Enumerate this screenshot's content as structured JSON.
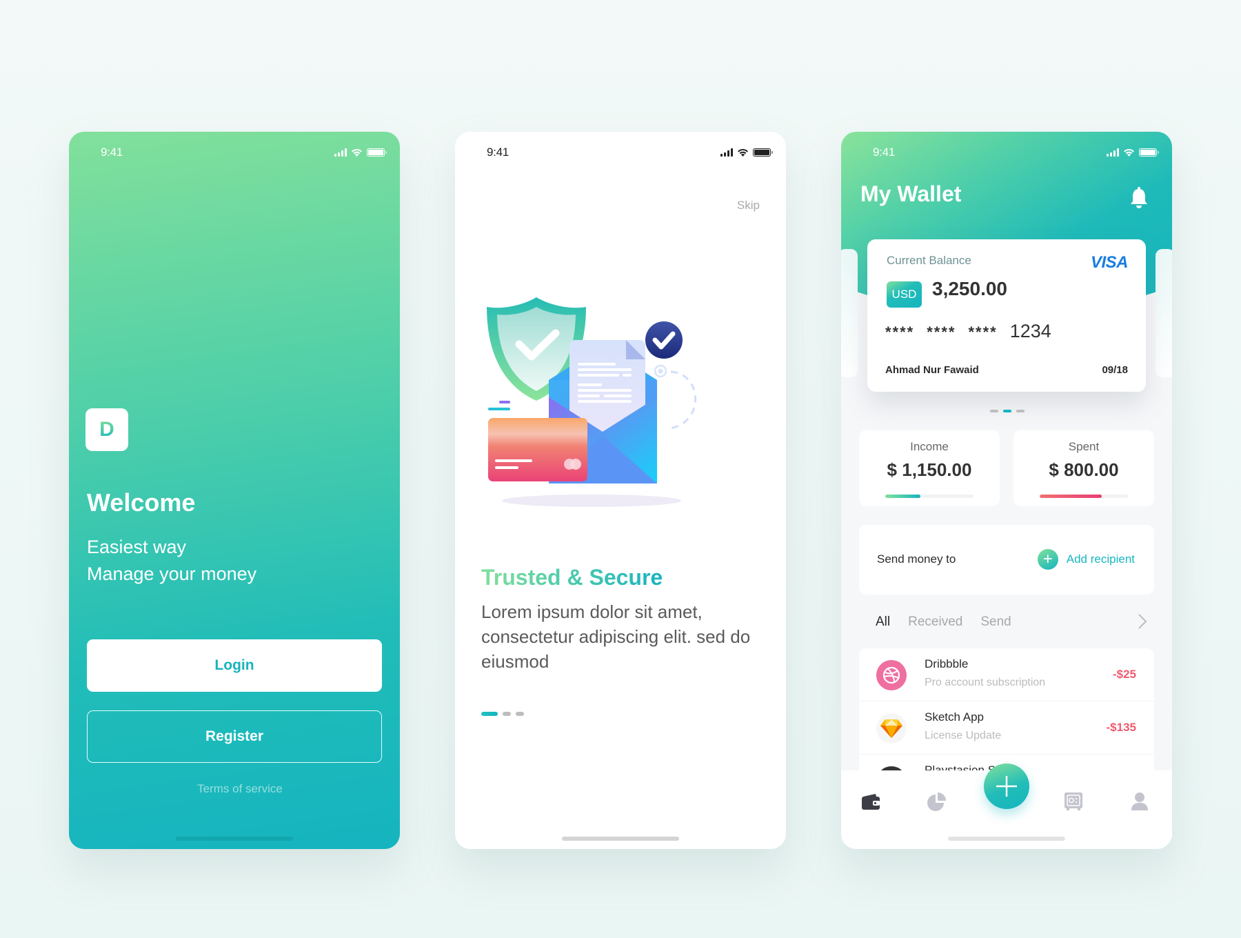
{
  "status_bar": {
    "time": "9:41"
  },
  "welcome_screen": {
    "logo_letter": "D",
    "title": "Welcome",
    "tagline_line1": "Easiest way",
    "tagline_line2": "Manage your money",
    "login_label": "Login",
    "register_label": "Register",
    "terms_label": "Terms of service"
  },
  "onboarding_screen": {
    "skip_label": "Skip",
    "title": "Trusted & Secure",
    "body": "Lorem ipsum dolor sit amet, consectetur adipiscing elit. sed do eiusmod",
    "pagination": {
      "total": 3,
      "active": 0
    },
    "illustration": "shield-card-envelope-illustration"
  },
  "wallet_screen": {
    "title": "My Wallet",
    "card": {
      "label": "Current Balance",
      "brand": "VISA",
      "currency": "USD",
      "balance": "3,250.00",
      "masked_groups": [
        "****",
        "****",
        "****"
      ],
      "last_four": "1234",
      "holder": "Ahmad Nur Fawaid",
      "expiry": "09/18"
    },
    "card_pagination": {
      "total": 3,
      "active": 1
    },
    "income": {
      "label": "Income",
      "value": "$ 1,150.00",
      "progress": 0.4
    },
    "spent": {
      "label": "Spent",
      "value": "$ 800.00",
      "progress": 0.7
    },
    "send_money": {
      "label": "Send money to",
      "add_label": "Add recipient"
    },
    "tabs": [
      {
        "label": "All",
        "active": true
      },
      {
        "label": "Received",
        "active": false
      },
      {
        "label": "Send",
        "active": false
      }
    ],
    "transactions": [
      {
        "name": "Dribbble",
        "desc": "Pro account subscription",
        "amount": "-$25",
        "icon": "dribbble-icon"
      },
      {
        "name": "Sketch App",
        "desc": "License Update",
        "amount": "-$135",
        "icon": "sketch-icon"
      },
      {
        "name": "Playstasion Store",
        "desc": "",
        "amount": "",
        "icon": "playstation-icon"
      }
    ],
    "bottom_nav": [
      {
        "name": "wallet",
        "active": true
      },
      {
        "name": "stats",
        "active": false
      },
      {
        "name": "add",
        "active": false
      },
      {
        "name": "safe",
        "active": false
      },
      {
        "name": "profile",
        "active": false
      }
    ]
  },
  "colors": {
    "accent_teal": "#15b4bf",
    "accent_green": "#82e09b",
    "negative_red": "#ee5a6f",
    "visa_blue": "#1a7ee0"
  }
}
